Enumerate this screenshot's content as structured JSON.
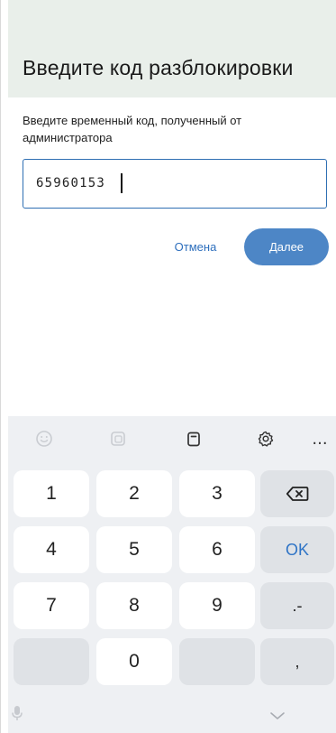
{
  "header": {
    "title": "Введите код разблокировки"
  },
  "dialog": {
    "instructions": "Введите временный код, полученный от администратора",
    "code_value": "65960153",
    "cancel_label": "Отмена",
    "next_label": "Далее"
  },
  "keyboard": {
    "toolbar": {
      "icons": [
        "emoji-icon",
        "sticker-icon",
        "clipboard-icon",
        "settings-icon",
        "more-icon"
      ],
      "more_label": "..."
    },
    "keys": {
      "k1": "1",
      "k2": "2",
      "k3": "3",
      "k4": "4",
      "k5": "5",
      "k6": "6",
      "k7": "7",
      "k8": "8",
      "k9": "9",
      "k0": "0",
      "ok": "OK",
      "dotdash": ".-",
      "comma": ","
    },
    "colors": {
      "accent": "#2f74c6",
      "key_bg": "#ffffff",
      "keyboard_bg": "#eef0f3"
    }
  }
}
